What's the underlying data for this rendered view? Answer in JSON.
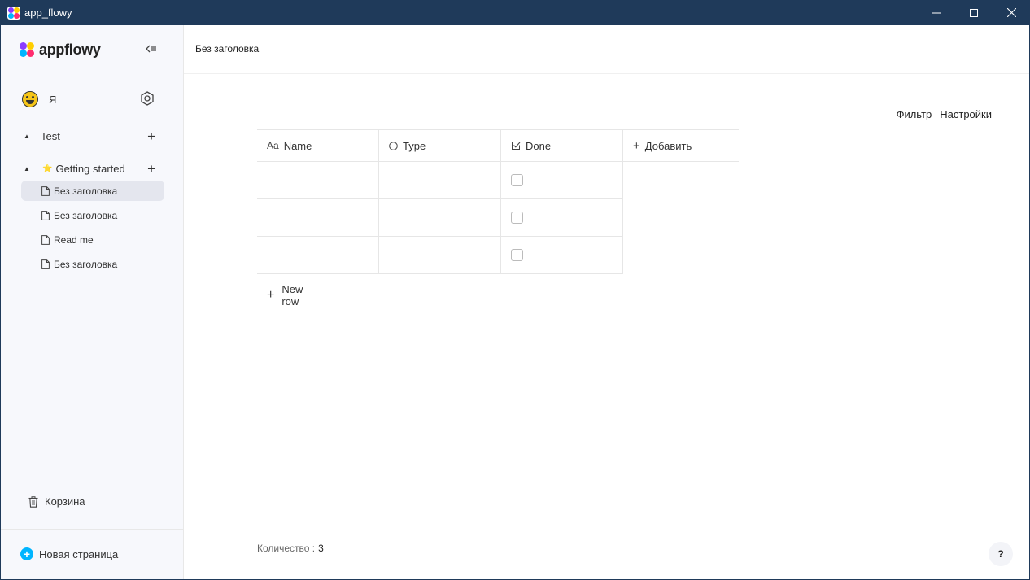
{
  "window": {
    "title": "app_flowy",
    "minimize": "—",
    "maximize": "☐",
    "close": "✕"
  },
  "sidebar": {
    "logo_text": "appflowy",
    "user": {
      "name": "Я"
    },
    "sections": [
      {
        "label": "Test"
      },
      {
        "label": "Getting started",
        "emoji": "⭐"
      }
    ],
    "pages": [
      {
        "label": "Без заголовка",
        "active": true
      },
      {
        "label": "Без заголовка"
      },
      {
        "label": "Read me"
      },
      {
        "label": "Без заголовка"
      }
    ],
    "trash_label": "Корзина",
    "new_page_label": "Новая страница"
  },
  "main": {
    "breadcrumb": "Без заголовка",
    "toolbar": {
      "filter": "Фильтр",
      "settings": "Настройки"
    },
    "columns": [
      {
        "icon": "Aa",
        "label": "Name",
        "icon_name": "text-field-icon"
      },
      {
        "icon": "⊙",
        "label": "Type",
        "icon_name": "single-select-icon"
      },
      {
        "icon": "☑",
        "label": "Done",
        "icon_name": "checkbox-field-icon"
      }
    ],
    "add_column_label": "Добавить",
    "rows": [
      {
        "name": "",
        "type": "",
        "done": false
      },
      {
        "name": "",
        "type": "",
        "done": false
      },
      {
        "name": "",
        "type": "",
        "done": false
      }
    ],
    "new_row_label": "New row",
    "count_label": "Количество :",
    "count_value": "3",
    "help_label": "?"
  }
}
